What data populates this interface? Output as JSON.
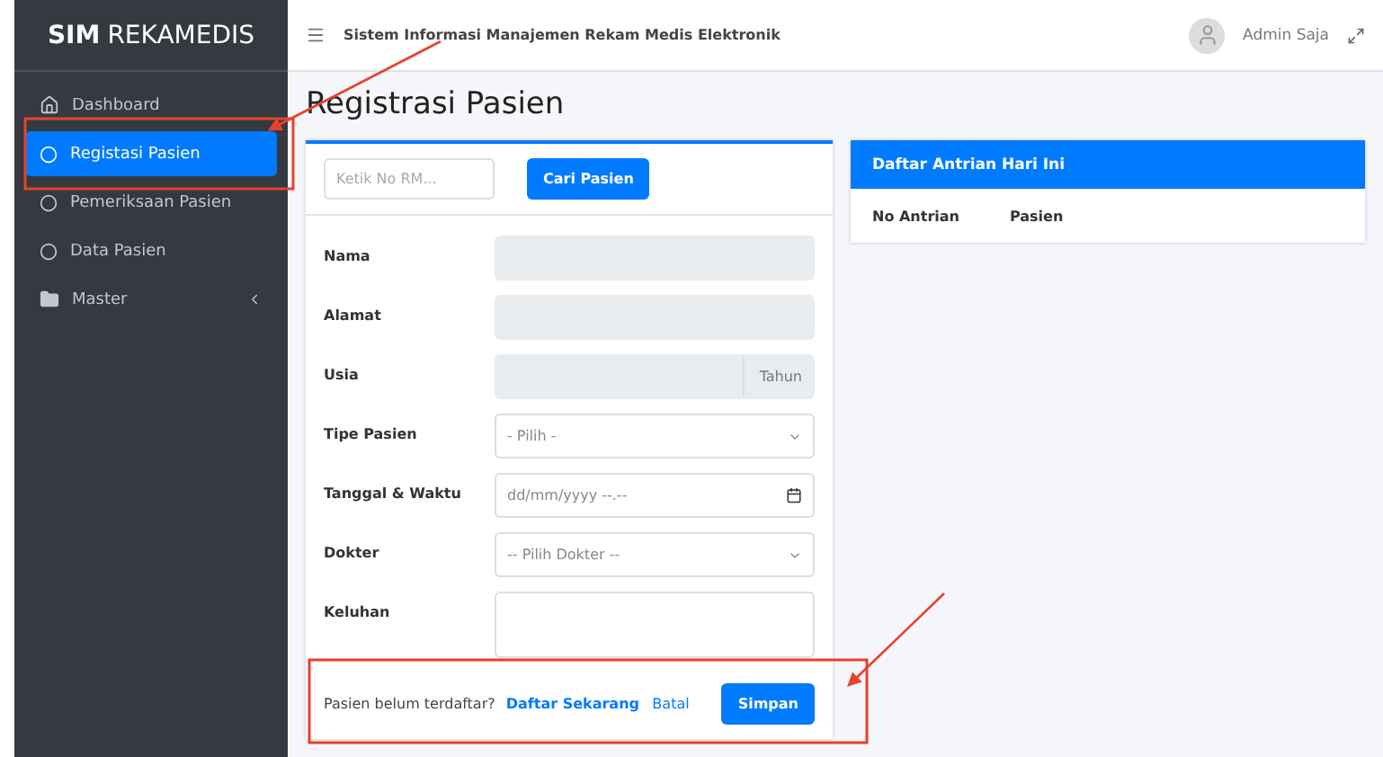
{
  "brand": {
    "bold": "SIM",
    "rest": "REKAMEDIS"
  },
  "sidebar": {
    "items": [
      {
        "label": "Dashboard",
        "kind": "home",
        "selected": false
      },
      {
        "label": "Registasi Pasien",
        "kind": "link",
        "selected": true
      },
      {
        "label": "Pemeriksaan Pasien",
        "kind": "link",
        "selected": false
      },
      {
        "label": "Data Pasien",
        "kind": "link",
        "selected": false
      },
      {
        "label": "Master",
        "kind": "group",
        "selected": false
      }
    ]
  },
  "topbar": {
    "title": "Sistem Informasi Manajemen Rekam Medis Elektronik",
    "user": "Admin Saja"
  },
  "page_title": "Registrasi Pasien",
  "form": {
    "search": {
      "placeholder": "Ketik No RM...",
      "button": "Cari Pasien"
    },
    "fields": [
      {
        "label": "Nama",
        "kind": "text",
        "disabled": true
      },
      {
        "label": "Alamat",
        "kind": "text",
        "disabled": true
      },
      {
        "label": "Usia",
        "kind": "addon",
        "disabled": true,
        "addon": "Tahun"
      },
      {
        "label": "Tipe Pasien",
        "kind": "select",
        "disabled": false,
        "value": "- Pilih -"
      },
      {
        "label": "Tanggal & Waktu",
        "kind": "datetime",
        "disabled": false,
        "value": "dd/mm/yyyy --.--"
      },
      {
        "label": "Dokter",
        "kind": "select",
        "disabled": false,
        "value": "-- Pilih Dokter --"
      },
      {
        "label": "Keluhan",
        "kind": "textarea",
        "disabled": false
      }
    ],
    "footer": {
      "question": "Pasien belum terdaftar?",
      "link": "Daftar Sekarang",
      "cancel": "Batal",
      "submit": "Simpan"
    }
  },
  "queue": {
    "title": "Daftar Antrian Hari Ini",
    "columns": [
      "No Antrian",
      "Pasien"
    ]
  }
}
